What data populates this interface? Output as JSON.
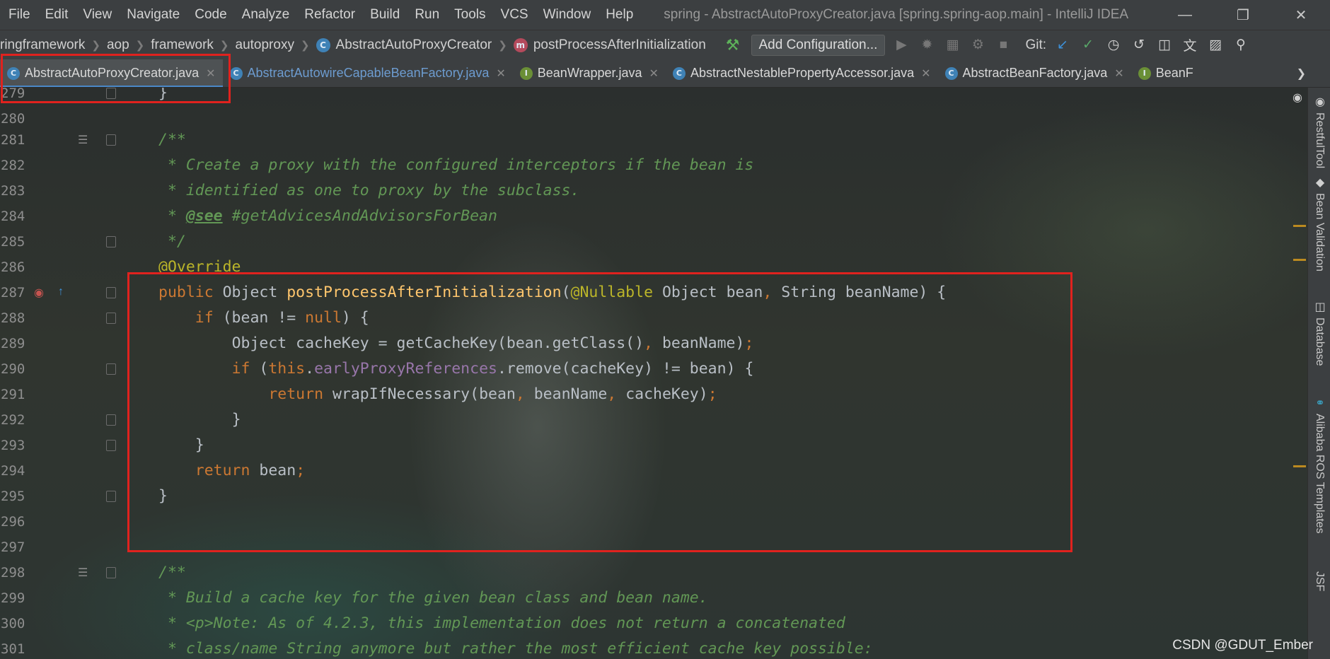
{
  "menu": {
    "items": [
      "File",
      "Edit",
      "View",
      "Navigate",
      "Code",
      "Analyze",
      "Refactor",
      "Build",
      "Run",
      "Tools",
      "VCS",
      "Window",
      "Help"
    ],
    "window_title": "spring - AbstractAutoProxyCreator.java [spring.spring-aop.main] - IntelliJ IDEA"
  },
  "breadcrumb": {
    "parts": [
      "ringframework",
      "aop",
      "framework",
      "autoproxy",
      "AbstractAutoProxyCreator",
      "postProcessAfterInitialization"
    ]
  },
  "toolbar": {
    "add_configuration": "Add Configuration...",
    "git_label": "Git:"
  },
  "tabs": [
    {
      "label": "AbstractAutoProxyCreator.java",
      "badge": "C",
      "active": true
    },
    {
      "label": "AbstractAutowireCapableBeanFactory.java",
      "badge": "C",
      "active": false
    },
    {
      "label": "BeanWrapper.java",
      "badge": "I",
      "active": false
    },
    {
      "label": "AbstractNestablePropertyAccessor.java",
      "badge": "C",
      "active": false
    },
    {
      "label": "AbstractBeanFactory.java",
      "badge": "C",
      "active": false
    },
    {
      "label": "BeanF",
      "badge": "I",
      "active": false
    }
  ],
  "editor": {
    "line_numbers": [
      "279",
      "280",
      "281",
      "282",
      "283",
      "284",
      "285",
      "286",
      "287",
      "288",
      "289",
      "290",
      "291",
      "292",
      "293",
      "294",
      "295",
      "296",
      "297",
      "298",
      "299",
      "300",
      "301"
    ],
    "code": {
      "l279": "}",
      "l281": "/**",
      "l282": " * Create a proxy with the configured interceptors if the bean is",
      "l283": " * identified as one to proxy by the subclass.",
      "l284_tag": "@see",
      "l284_rest": " #getAdvicesAndAdvisorsForBean",
      "l285": " */",
      "l286": "@Override",
      "l287_kw": "public",
      "l287_type": " Object ",
      "l287_fn": "postProcessAfterInitialization",
      "l287_paren": "(",
      "l287_ann": "@Nullable",
      "l287_p1": " Object bean",
      "l287_comma": ",",
      "l287_p2": " String beanName) {",
      "l288_kw": "if",
      "l288_a": " (bean != ",
      "l288_null": "null",
      "l288_b": ") {",
      "l289_a": "Object cacheKey = getCacheKey(bean.getClass()",
      "l289_comma": ",",
      "l289_b": " beanName)",
      "l289_semi": ";",
      "l290_kw": "if",
      "l290_a": " (",
      "l290_this": "this",
      "l290_dot": ".",
      "l290_fld": "earlyProxyReferences",
      "l290_b": ".remove(cacheKey) != bean) {",
      "l291_kw": "return",
      "l291_a": " wrapIfNecessary(bean",
      "l291_c1": ",",
      "l291_b": " beanName",
      "l291_c2": ",",
      "l291_c": " cacheKey)",
      "l291_semi": ";",
      "l292": "}",
      "l293": "}",
      "l294_kw": "return",
      "l294_a": " bean",
      "l294_semi": ";",
      "l295": "}",
      "l298": "/**",
      "l299": " * Build a cache key for the given bean class and bean name.",
      "l300": " * <p>Note: As of 4.2.3, this implementation does not return a concatenated",
      "l301": " * class/name String anymore but rather the most efficient cache key possible:"
    }
  },
  "right_panel": {
    "tabs": [
      "RestfulTool",
      "Bean Validation",
      "Database",
      "Alibaba ROS Templates",
      "JSF"
    ]
  },
  "watermark": "CSDN @GDUT_Ember",
  "colors": {
    "keyword": "#cc7832",
    "method": "#ffc66d",
    "annotation": "#bbb529",
    "field": "#9876aa",
    "comment": "#629755",
    "highlight_box": "#e0221e"
  }
}
